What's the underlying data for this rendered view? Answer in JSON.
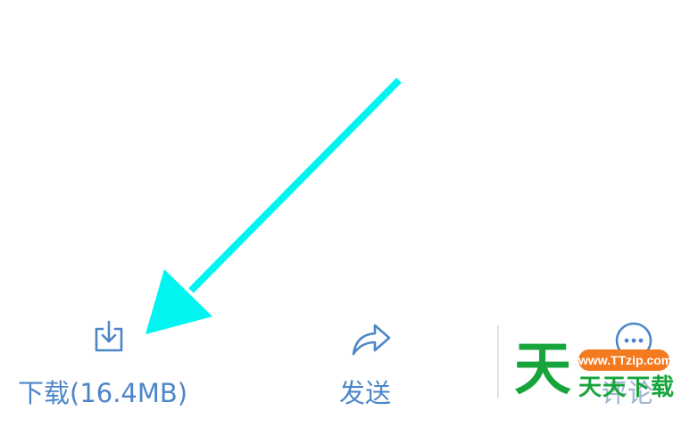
{
  "toolbar": {
    "download": {
      "label": "下载(16.4MB)",
      "icon": "download-icon"
    },
    "send": {
      "label": "发送",
      "icon": "share-icon"
    },
    "comment": {
      "label": "评论",
      "icon": "comment-icon"
    }
  },
  "annotation": {
    "arrow_color": "#00f5f0",
    "arrow_target": "download-button"
  },
  "watermark": {
    "logo_char": "天",
    "site": "www.TTzip.com",
    "name": "天天下载",
    "green": "#18a43c",
    "orange": "#f47a1f"
  },
  "colors": {
    "accent": "#4d86c8"
  }
}
